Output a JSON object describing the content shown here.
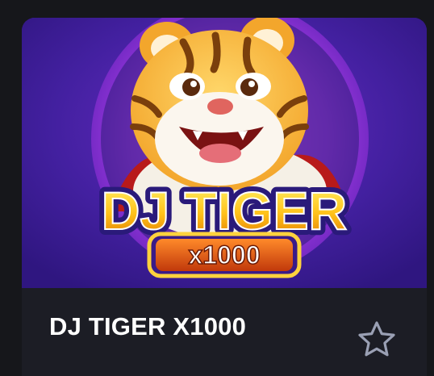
{
  "game": {
    "title": "DJ TIGER X1000",
    "logo_text": "DJ TIGER",
    "logo_badge": "x1000"
  },
  "icons": {
    "favorite": "star-outline-icon"
  },
  "colors": {
    "page_bg": "#16171b",
    "card_footer_bg": "#1c1d25",
    "thumbnail_bg": "#3d1d91",
    "title_text": "#ffffff",
    "star_outline": "#9aa0b4"
  }
}
